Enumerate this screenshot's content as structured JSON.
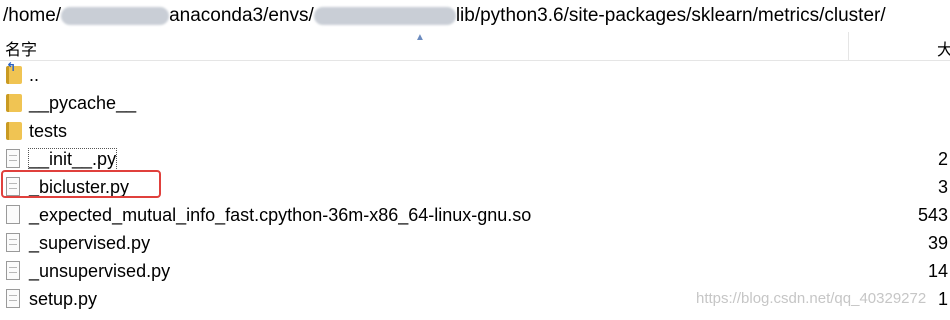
{
  "path_bar": {
    "part_home": "/home/",
    "part_anaconda": "anaconda3/envs/",
    "part_rest": "lib/python3.6/site-packages/sklearn/metrics/cluster/"
  },
  "columns": {
    "name": "名字",
    "size": "大"
  },
  "files": [
    {
      "name": "..",
      "type": "parent",
      "size": ""
    },
    {
      "name": "__pycache__",
      "type": "folder",
      "size": ""
    },
    {
      "name": "tests",
      "type": "folder",
      "size": ""
    },
    {
      "name": "__init__.py",
      "type": "file",
      "size": "2"
    },
    {
      "name": "_bicluster.py",
      "type": "file",
      "size": "3"
    },
    {
      "name": "_expected_mutual_info_fast.cpython-36m-x86_64-linux-gnu.so",
      "type": "file",
      "size": "543"
    },
    {
      "name": "_supervised.py",
      "type": "file",
      "size": "39"
    },
    {
      "name": "_unsupervised.py",
      "type": "file",
      "size": "14"
    },
    {
      "name": "setup.py",
      "type": "file",
      "size": "1"
    }
  ],
  "watermark": "https://blog.csdn.net/qq_40329272",
  "colors": {
    "highlight_border": "#e0403c",
    "folder": "#f0c453"
  }
}
